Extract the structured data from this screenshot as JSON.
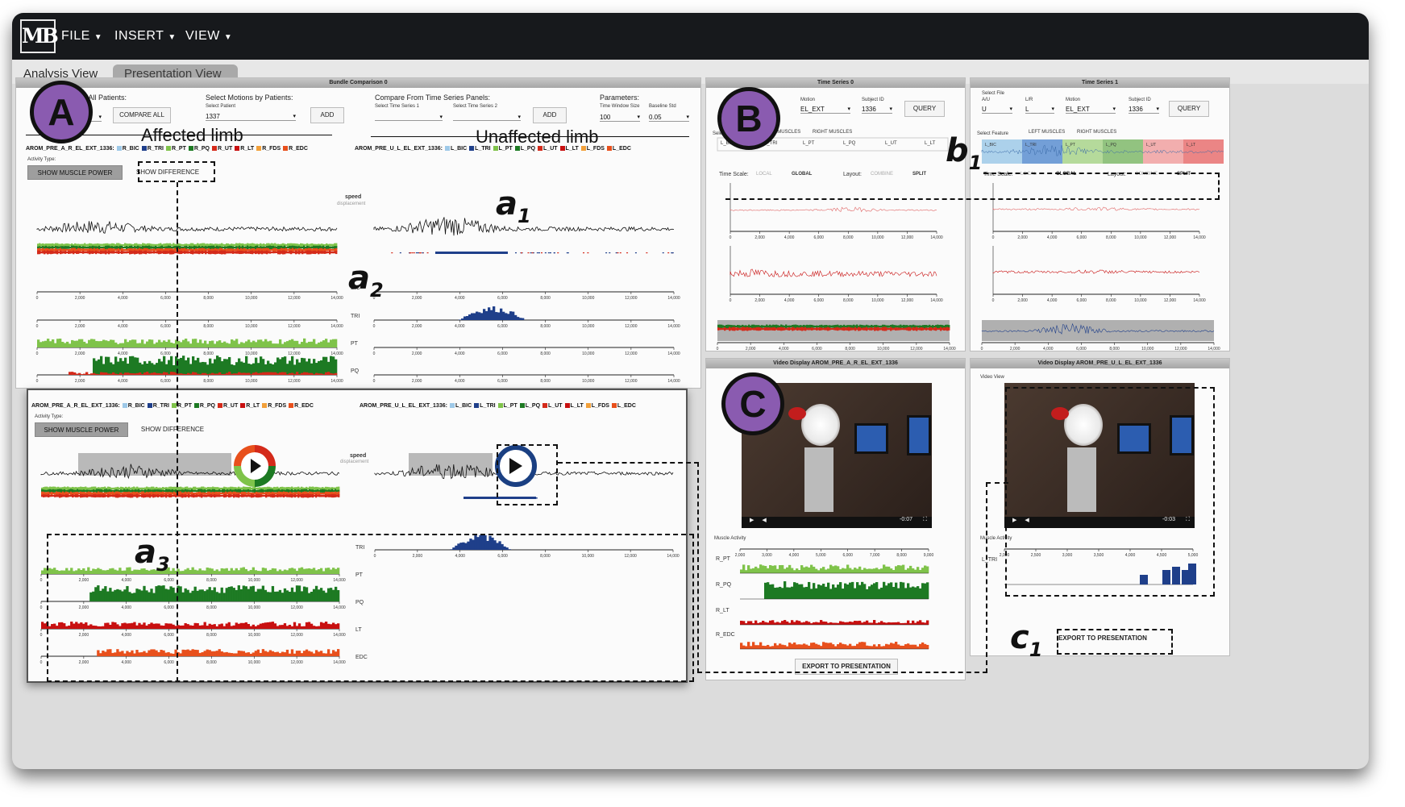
{
  "menubar": {
    "logo": "MB",
    "file": "FILE",
    "insert": "INSERT",
    "view": "VIEW"
  },
  "tabs": {
    "analysis": "Analysis View",
    "presentation": "Presentation View"
  },
  "bundle": {
    "title": "Bundle Comparison 0",
    "all_patients": "s for All Patients:",
    "motion_sel": "tion",
    "compare_all": "COMPARE ALL",
    "by_patients": "Select Motions by Patients:",
    "select_patient": "Select Patient",
    "patient_val": "1337",
    "add": "ADD",
    "compare_from": "Compare From Time Series Panels:",
    "ts1": "Select Time Series 1",
    "ts2": "Select Time Series 2",
    "parameters": "Parameters:",
    "tws": "Time Window Size",
    "tws_val": "100",
    "bstd": "Baseline Std",
    "bstd_val": "0.05",
    "affected": "Affected limb",
    "unaffected": "Unaffected limb",
    "left_title": "AROM_PRE_A_R_EL_EXT_1336:",
    "right_title": "AROM_PRE_U_L_EL_EXT_1336:",
    "left_legend": [
      "R_BIC",
      "R_TRI",
      "R_PT",
      "R_PQ",
      "R_UT",
      "R_LT",
      "R_FDS",
      "R_EDC"
    ],
    "right_legend": [
      "L_BIC",
      "L_TRI",
      "L_PT",
      "L_PQ",
      "L_UT",
      "L_LT",
      "L_FDS",
      "L_EDC"
    ],
    "activity_type": "Activity Type:",
    "show_power": "SHOW MUSCLE POWER",
    "show_diff": "SHOW DIFFERENCE",
    "speed": "speed",
    "displacement": "displacement",
    "muscles": [
      "BIC",
      "TRI",
      "PT",
      "PQ"
    ],
    "muscles2": [
      "TRI",
      "PT",
      "PQ",
      "LT",
      "EDC"
    ],
    "ticks": [
      "0",
      "2,000",
      "4,000",
      "6,000",
      "8,000",
      "10,000",
      "12,000",
      "14,000"
    ]
  },
  "ts0": {
    "title": "Time Series 0",
    "motion_lbl": "Motion",
    "motion": "EL_EXT",
    "subject_lbl": "Subject ID",
    "subject": "1336",
    "query": "QUERY",
    "select": "Select",
    "left_muscles": "LEFT MUSCLES",
    "right_muscles": "RIGHT MUSCLES",
    "features": [
      "L_BIC",
      "L_TRI",
      "L_PT",
      "L_PQ",
      "L_UT",
      "L_LT"
    ],
    "time_scale": "Time Scale:",
    "local": "LOCAL",
    "global": "GLOBAL",
    "layout": "Layout:",
    "combine": "COMBINE",
    "split": "SPLIT"
  },
  "ts1": {
    "title": "Time Series 1",
    "file_lbl": "Select File",
    "au_lbl": "A/U",
    "au": "U",
    "lr_lbl": "L/R",
    "lr": "L",
    "motion_lbl": "Motion",
    "motion": "EL_EXT",
    "subject_lbl": "Subject ID",
    "subject": "1336",
    "query": "QUERY",
    "select_feature": "Select Feature"
  },
  "video0": {
    "title": "Video Display AROM_PRE_A_R_EL_EXT_1336",
    "muscle_activity": "Muscle Activity",
    "rows": [
      "R_PT",
      "R_PQ",
      "R_LT",
      "R_EDC"
    ],
    "time": "-0:07",
    "ticks": [
      "2,000",
      "3,000",
      "4,000",
      "5,000",
      "6,000",
      "7,000",
      "8,000",
      "9,000"
    ],
    "export": "EXPORT TO PRESENTATION"
  },
  "video1": {
    "title": "Video Display AROM_PRE_U_L_EL_EXT_1336",
    "video_view": "Video View",
    "muscle_activity": "Muscle Activity",
    "rows": [
      "L_TRI"
    ],
    "time": "-0:03",
    "ticks": [
      "2,000",
      "2,500",
      "3,000",
      "3,500",
      "4,000",
      "4,500",
      "5,000"
    ],
    "export": "EXPORT TO PRESENTATION"
  },
  "annotations": {
    "A": "A",
    "B": "B",
    "C": "C",
    "a1": "a",
    "a1s": "1",
    "a2": "a",
    "a2s": "2",
    "a3": "a",
    "a3s": "3",
    "b1": "b",
    "b1s": "1",
    "c1": "c",
    "c1s": "1"
  },
  "colors": {
    "bic": "#9ec9e8",
    "tri": "#1f3f8a",
    "pt": "#7fc34a",
    "pq": "#1d7a23",
    "ut": "#d42a1a",
    "lt": "#c81010",
    "fds": "#f2a03a",
    "edc": "#e8501c"
  }
}
